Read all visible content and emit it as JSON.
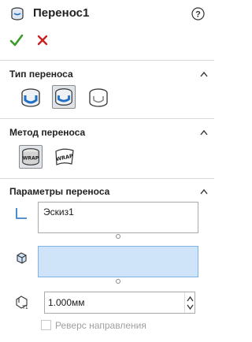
{
  "header": {
    "title": "Перенос1",
    "icon": "wrap-feature-icon",
    "help_icon": "help-icon"
  },
  "actions": {
    "ok_icon": "checkmark-icon",
    "cancel_icon": "close-icon",
    "ok_color": "#3a9a2a",
    "cancel_color": "#c82020"
  },
  "sections": {
    "wrap_type": {
      "title": "Тип переноса",
      "options": [
        {
          "name": "emboss",
          "icon": "emboss-icon",
          "selected": false
        },
        {
          "name": "deboss",
          "icon": "deboss-icon",
          "selected": true
        },
        {
          "name": "scribe",
          "icon": "scribe-icon",
          "selected": false
        }
      ]
    },
    "wrap_method": {
      "title": "Метод переноса",
      "options": [
        {
          "name": "analytical",
          "icon": "wrap-analytical-icon",
          "label": "WRAP",
          "selected": true
        },
        {
          "name": "spline-surface",
          "icon": "wrap-spline-icon",
          "label": "WRAP",
          "selected": false
        }
      ]
    },
    "wrap_params": {
      "title": "Параметры переноса",
      "sketch_value": "Эскиз1",
      "face_value": "",
      "thickness": "1.000мм",
      "reverse_label": "Реверс направления",
      "reverse_checked": false,
      "reverse_enabled": false,
      "selection_color": "#cfe4f8"
    }
  }
}
